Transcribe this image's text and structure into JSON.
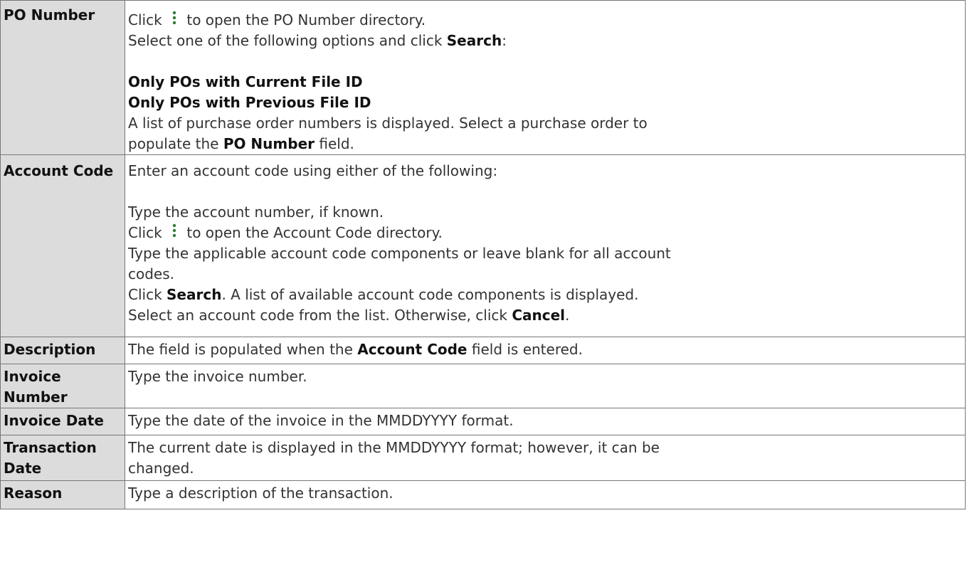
{
  "rows": [
    {
      "label": "PO Number",
      "line1_a": "Click ",
      "line1_icon": "vertical-ellipsis-icon",
      "line1_b": " to open the PO Number directory.",
      "line2_a": "Select one of the following options and click ",
      "line2_bold": "Search",
      "line2_b": ":",
      "option1": "Only POs with Current File ID",
      "option2": "Only POs with Previous File ID",
      "line3": "A list of purchase order numbers is displayed. Select a purchase order to",
      "line4_a": "populate the ",
      "line4_bold": "PO Number",
      "line4_b": " field."
    },
    {
      "label": "Account Code",
      "line1": "Enter an account code using either of the following:",
      "line2": "Type the account number, if known.",
      "line3_a": "Click ",
      "line3_icon": "vertical-ellipsis-icon",
      "line3_b": " to open the Account Code directory.",
      "line4": "Type the applicable account code components or leave blank for all account",
      "line5": "codes.",
      "line6_a": "Click ",
      "line6_bold": "Search",
      "line6_b": ". A list of available account code components is displayed.",
      "line7_a": "Select an account code from the list. Otherwise, click ",
      "line7_bold": "Cancel",
      "line7_b": "."
    },
    {
      "label": "Description",
      "text_a": "The field is populated when the ",
      "text_bold": "Account Code",
      "text_b": " field is entered."
    },
    {
      "label": "Invoice Number",
      "text": "Type the invoice number."
    },
    {
      "label": "Invoice Date",
      "text": "Type the date of the invoice in the MMDDYYYY format."
    },
    {
      "label": "Transaction Date",
      "line1": "The current date is displayed in the MMDDYYYY format; however, it can be",
      "line2": "changed."
    },
    {
      "label": "Reason",
      "text": "Type a description of the transaction."
    }
  ],
  "colors": {
    "label_background": "#dcdcdc",
    "border": "#777777",
    "icon": "#2e7d32"
  }
}
